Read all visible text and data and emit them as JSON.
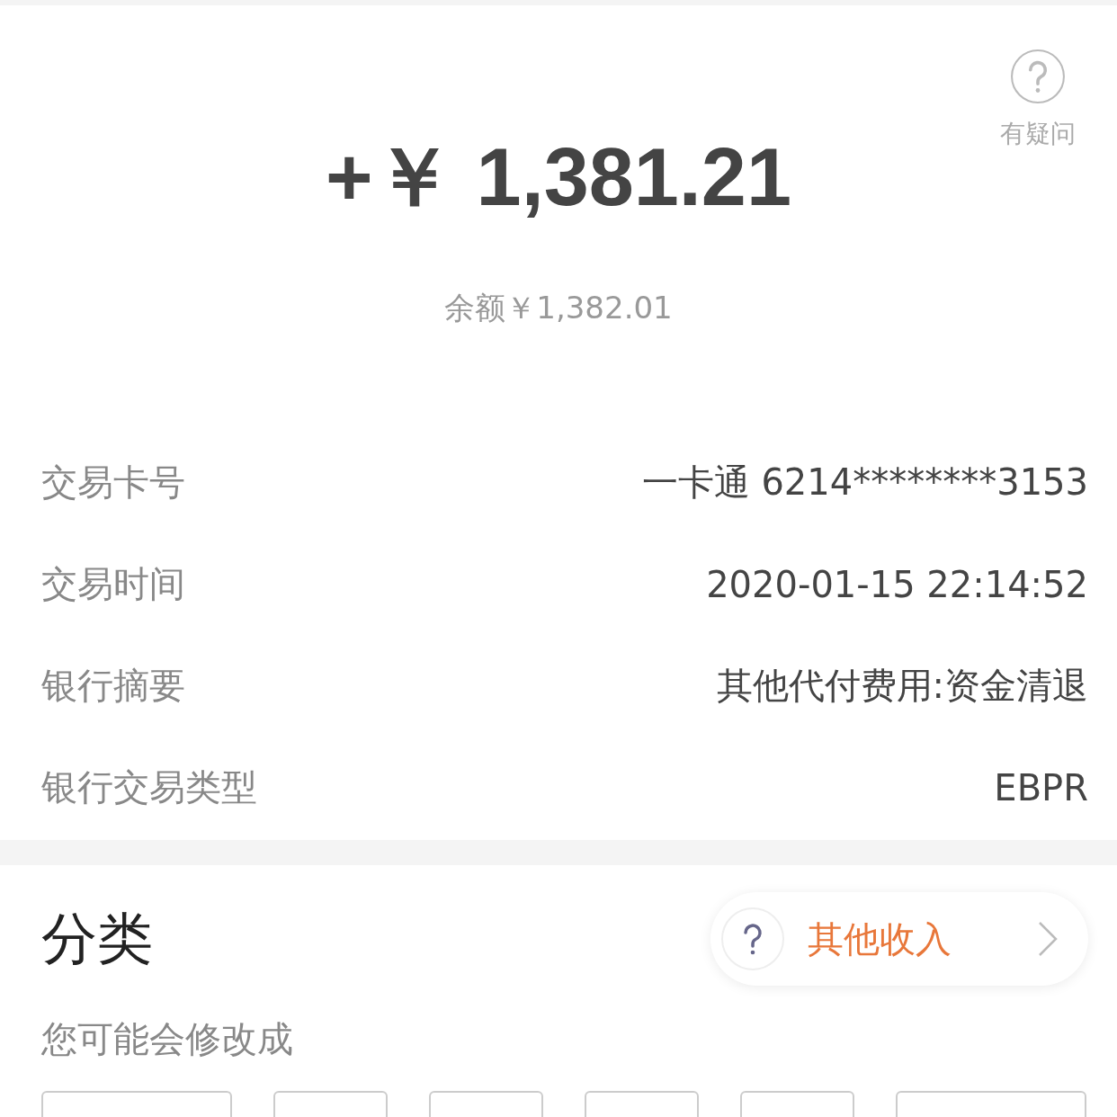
{
  "help": {
    "label": "有疑问"
  },
  "amount": "+￥ 1,381.21",
  "balance": "余额￥1,382.01",
  "details": [
    {
      "label": "交易卡号",
      "value": "一卡通 6214********3153"
    },
    {
      "label": "交易时间",
      "value": "2020-01-15 22:14:52"
    },
    {
      "label": "银行摘要",
      "value": "其他代付费用:资金清退"
    },
    {
      "label": "银行交易类型",
      "value": "EBPR"
    }
  ],
  "category": {
    "title": "分类",
    "current": "其他收入",
    "subtitle": "您可能会修改成",
    "suggestion_chips": [
      {
        "kind": "chip"
      },
      {
        "kind": "chip"
      },
      {
        "kind": "chip"
      },
      {
        "kind": "chip"
      },
      {
        "kind": "chip"
      },
      {
        "kind": "chip"
      }
    ]
  }
}
